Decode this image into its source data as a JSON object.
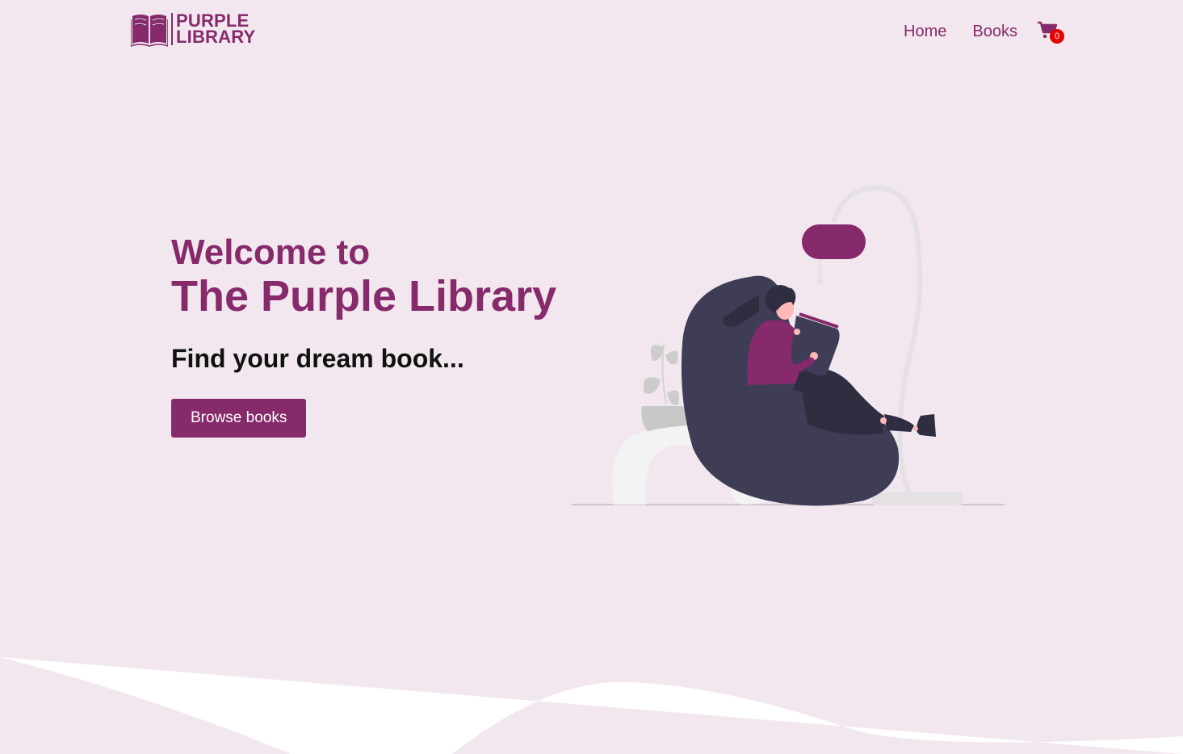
{
  "brand": {
    "line1": "PURPLE",
    "line2": "LIBRARY",
    "color": "#862a6b"
  },
  "nav": {
    "items": [
      {
        "label": "Home"
      },
      {
        "label": "Books"
      }
    ],
    "cart_icon": "shopping-cart-icon",
    "cart_count": "0",
    "badge_color": "#e60000"
  },
  "hero": {
    "line1": "Welcome to",
    "line2": "The Purple Library",
    "subtitle": "Find your dream book...",
    "button_label": "Browse books"
  },
  "illustration": {
    "icon": "woman-reading-on-beanbag-illustration"
  },
  "colors": {
    "background": "#f2e7ef",
    "accent": "#862a6b",
    "text": "#111111",
    "wave": "#ffffff"
  }
}
